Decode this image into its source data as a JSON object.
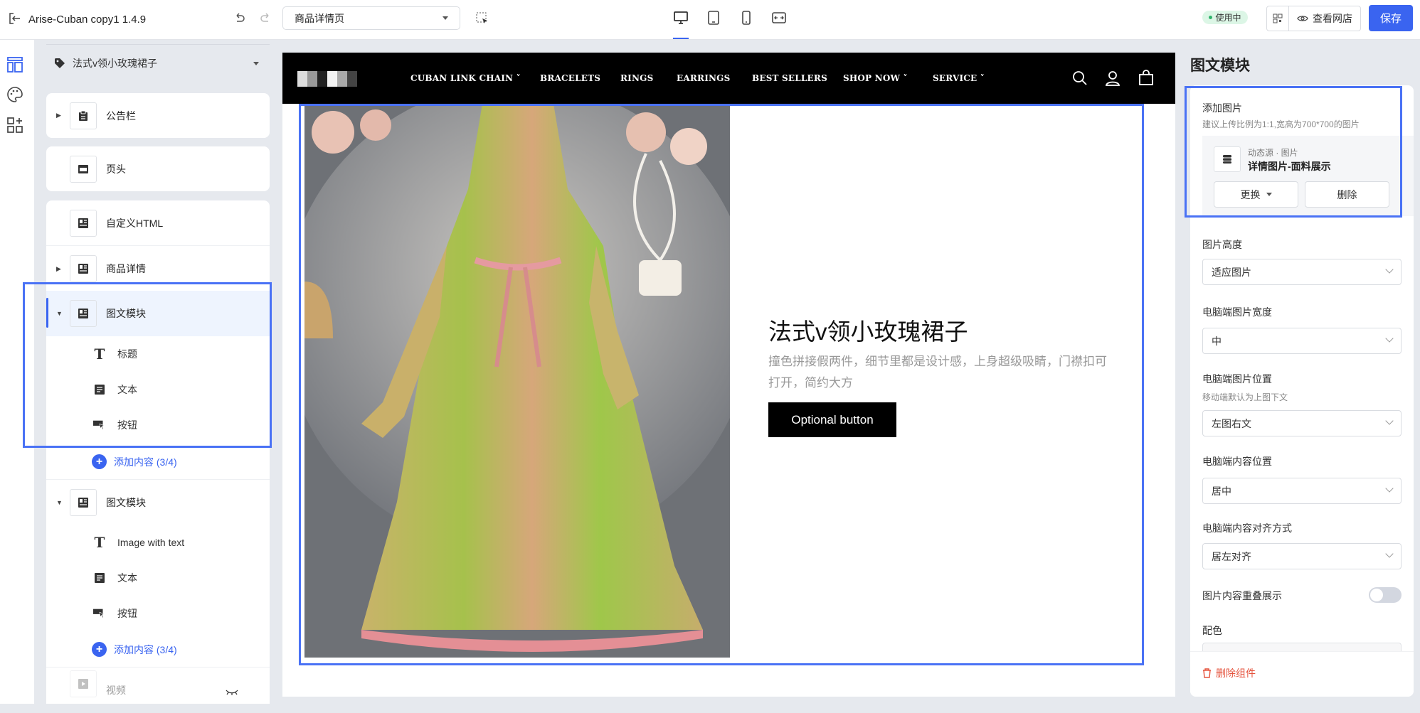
{
  "topbar": {
    "app_title": "Arise-Cuban copy1  1.4.9",
    "page_select": "商品详情页",
    "status_badge": "使用中",
    "view_store": "查看网店",
    "save": "保存"
  },
  "left_panel": {
    "product_selector": "法式v领小玫瑰裙子",
    "sections": [
      {
        "label": "公告栏"
      },
      {
        "label": "页头"
      },
      {
        "label": "自定义HTML"
      },
      {
        "label": "商品详情"
      },
      {
        "label": "图文模块",
        "children": [
          "标题",
          "文本",
          "按钮"
        ],
        "add_label": "添加内容 (3/4)"
      },
      {
        "label": "图文模块",
        "children": [
          "Image with text",
          "文本",
          "按钮"
        ],
        "add_label": "添加内容 (3/4)"
      },
      {
        "label": "视频"
      }
    ]
  },
  "preview": {
    "nav": [
      "CUBAN LINK CHAIN",
      "BRACELETS",
      "RINGS",
      "EARRINGS",
      "BEST SELLERS",
      "SHOP NOW",
      "SERVICE"
    ],
    "heading": "法式v领小玫瑰裙子",
    "body": "撞色拼接假两件，细节里都是设计感，上身超级吸睛，门襟扣可打开，简约大方",
    "button": "Optional button"
  },
  "right_panel": {
    "title": "图文模块",
    "add_image": "添加图片",
    "add_image_hint": "建议上传比例为1:1,宽高为700*700的图片",
    "source_type": "动态源 · 图片",
    "source_name": "详情图片-面料展示",
    "replace": "更换",
    "delete": "删除",
    "fields": [
      {
        "label": "图片高度",
        "value": "适应图片"
      },
      {
        "label": "电脑端图片宽度",
        "value": "中"
      },
      {
        "label": "电脑端图片位置",
        "hint": "移动端默认为上图下文",
        "value": "左图右文"
      },
      {
        "label": "电脑端内容位置",
        "value": "居中"
      },
      {
        "label": "电脑端内容对齐方式",
        "value": "居左对齐"
      }
    ],
    "overlap_label": "图片内容重叠展示",
    "overlap_on": false,
    "color_label": "配色",
    "delete_component": "删除组件"
  },
  "colors": {
    "accent": "#3a64f0",
    "danger": "#e5533d",
    "selection": "#4a72f5"
  }
}
